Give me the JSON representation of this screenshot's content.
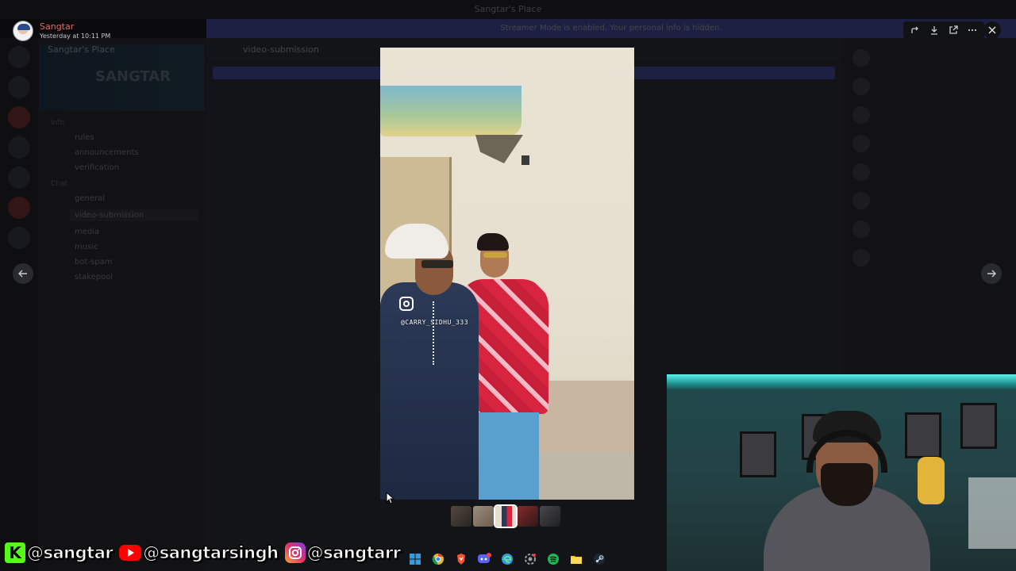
{
  "background_app": {
    "window_title": "Sangtar's Place",
    "banner_text": "Streamer Mode is enabled. Your personal info is hidden.",
    "server_name": "Sangtar's Place",
    "server_banner_text": "SANGTAR",
    "channel_header": "video-submission",
    "categories": [
      "Info",
      "Chat"
    ],
    "channels": [
      "rules",
      "announcements",
      "verification",
      "general",
      "video-submission",
      "media",
      "music",
      "bot-spam",
      "stakepool"
    ],
    "active_channel": "video-submission"
  },
  "viewer": {
    "uploader_name": "Sangtar",
    "uploader_time": "Yesterday at 10:11 PM",
    "toolbar": [
      {
        "name": "forward-icon",
        "glyph": "↱"
      },
      {
        "name": "download-icon",
        "glyph": "⤓"
      },
      {
        "name": "open-external-icon",
        "glyph": "⧉"
      },
      {
        "name": "more-icon",
        "glyph": "···"
      }
    ],
    "close_glyph": "✕",
    "prev_glyph": "←",
    "next_glyph": "→",
    "video_watermark_handle": "@CARRY_SIDHU_333",
    "thumbnail_count": 5,
    "selected_thumbnail": 3
  },
  "overlay": {
    "socials": [
      {
        "icon": "kick-icon",
        "glyph": "K",
        "handle": "@sangtar"
      },
      {
        "icon": "youtube-icon",
        "glyph": "▶",
        "handle": "@sangtarsingh"
      },
      {
        "icon": "instagram-icon",
        "glyph": "◎",
        "handle": "@sangtarr"
      }
    ],
    "taskbar_apps": [
      {
        "name": "windows-icon",
        "color": "#3a9bdc"
      },
      {
        "name": "chrome-icon",
        "color": "#e8b32e"
      },
      {
        "name": "brave-icon",
        "color": "#fb542b"
      },
      {
        "name": "discord-icon",
        "color": "#5865f2"
      },
      {
        "name": "edge-icon",
        "color": "#2e9fd8"
      },
      {
        "name": "settings-icon",
        "color": "#9aa0a6"
      },
      {
        "name": "spotify-icon",
        "color": "#1db954"
      },
      {
        "name": "file-explorer-icon",
        "color": "#f4c430"
      },
      {
        "name": "steam-icon",
        "color": "#c7d5e0"
      }
    ]
  },
  "colors": {
    "uploader_name": "#e66b62",
    "accent": "#5865f2",
    "kick_green": "#53fc18"
  }
}
